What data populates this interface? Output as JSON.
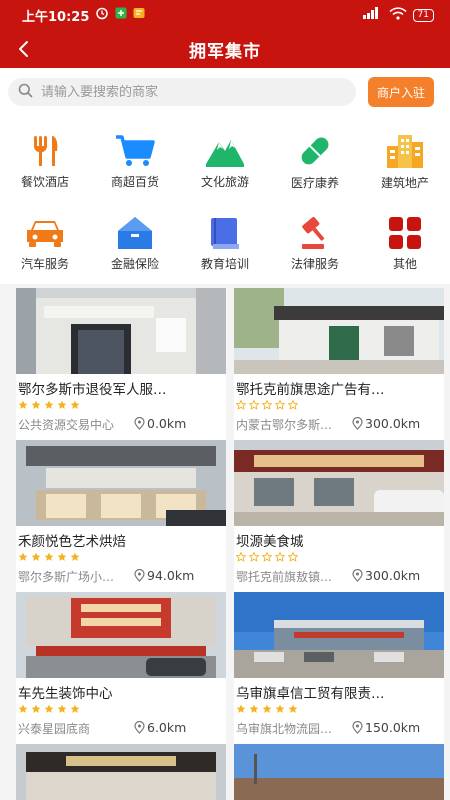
{
  "status_bar": {
    "time": "上午10:25",
    "battery": "71"
  },
  "header": {
    "title": "拥军集市"
  },
  "search": {
    "placeholder": "请输入要搜索的商家",
    "merchant_button": "商户入驻"
  },
  "categories": [
    {
      "label": "餐饮酒店",
      "icon": "fork-knife-icon",
      "color": "#f07a18"
    },
    {
      "label": "商超百货",
      "icon": "shopping-cart-icon",
      "color": "#1a8cff"
    },
    {
      "label": "文化旅游",
      "icon": "mountain-icon",
      "color": "#1fb56a"
    },
    {
      "label": "医疗康养",
      "icon": "pill-icon",
      "color": "#1fb56a"
    },
    {
      "label": "建筑地产",
      "icon": "buildings-icon",
      "color": "#f5a623"
    },
    {
      "label": "汽车服务",
      "icon": "car-icon",
      "color": "#f07a18"
    },
    {
      "label": "金融保险",
      "icon": "bank-icon",
      "color": "#2a7be6"
    },
    {
      "label": "教育培训",
      "icon": "book-icon",
      "color": "#4b6ee6"
    },
    {
      "label": "法律服务",
      "icon": "gavel-icon",
      "color": "#e8473c"
    },
    {
      "label": "其他",
      "icon": "grid-icon",
      "color": "#c8140f"
    }
  ],
  "listings": [
    {
      "name": "鄂尔多斯市退役军人服…",
      "stars_filled": 5,
      "location": "公共资源交易中心",
      "distance": "0.0km"
    },
    {
      "name": "鄂托克前旗思途广告有…",
      "stars_filled": 0,
      "location": "内蒙古鄂尔多斯…",
      "distance": "300.0km"
    },
    {
      "name": "禾颜悦色艺术烘焙",
      "stars_filled": 5,
      "location": "鄂尔多斯广场小…",
      "distance": "94.0km"
    },
    {
      "name": "坝源美食城",
      "stars_filled": 0,
      "location": "鄂托克前旗敖镇…",
      "distance": "300.0km"
    },
    {
      "name": "车先生装饰中心",
      "stars_filled": 5,
      "location": "兴泰星园底商",
      "distance": "6.0km"
    },
    {
      "name": "乌审旗卓信工贸有限责…",
      "stars_filled": 5,
      "location": "乌审旗北物流园…",
      "distance": "150.0km"
    }
  ],
  "colors": {
    "brand_red": "#c8140f",
    "accent_orange": "#f5802c",
    "star_gold": "#f5b324"
  }
}
